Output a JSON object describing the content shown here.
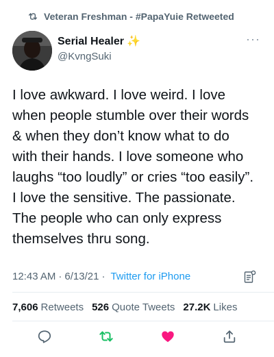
{
  "retweet_banner": {
    "text": "Veteran Freshman - #PapaYuie Retweeted",
    "icon": "retweet-icon"
  },
  "author": {
    "display_name": "Serial Healer",
    "badge": "✨",
    "handle": "@KvngSuki",
    "avatar_icon": "user-avatar"
  },
  "tweet": {
    "text": "I love awkward. I love weird. I love\nwhen people stumble over their words\n& when they don’t know what to do\nwith their hands. I love someone who\nlaughs “too loudly” or cries “too easily”.\nI love the sensitive. The passionate.\nThe people who can only express\nthemselves thru song."
  },
  "meta": {
    "time": "12:43 AM",
    "separator1": "·",
    "date": "6/13/21",
    "separator2": "·",
    "source": "Twitter for iPhone"
  },
  "stats": {
    "retweets_count": "7,606",
    "retweets_label": "Retweets",
    "quotes_count": "526",
    "quotes_label": "Quote Tweets",
    "likes_count": "27.2K",
    "likes_label": "Likes"
  },
  "colors": {
    "accent": "#1d9bf0",
    "retweet_green": "#17bf63",
    "like_pink": "#f91880",
    "muted": "#536471"
  }
}
